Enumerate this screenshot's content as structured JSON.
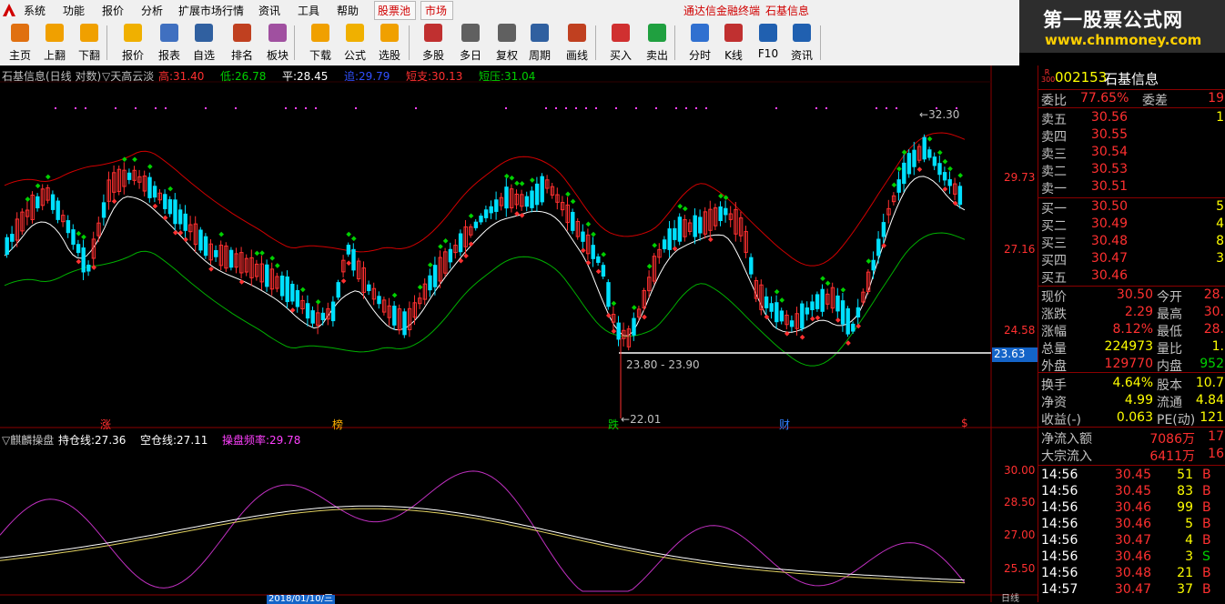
{
  "menubar": {
    "items": [
      "系统",
      "功能",
      "报价",
      "分析",
      "扩展市场行情",
      "资讯",
      "工具",
      "帮助"
    ],
    "tabs": [
      "股票池",
      "市场"
    ],
    "title": "通达信金融终端",
    "stock_name_title": "石基信息"
  },
  "watermark": {
    "title": "第一股票公式网",
    "url": "www.chnmoney.com"
  },
  "toolbar": {
    "buttons": [
      "主页",
      "上翻",
      "下翻",
      "报价",
      "报表",
      "自选",
      "排名",
      "板块",
      "下载",
      "公式",
      "选股",
      "多股",
      "多日",
      "复权",
      "周期",
      "画线",
      "买入",
      "卖出",
      "分时",
      "K线",
      "F10",
      "资讯"
    ]
  },
  "main_chart": {
    "header": {
      "title": "石基信息(日线 对数)",
      "indicator": "天高云淡",
      "items": [
        {
          "label": "高:",
          "value": "31.40",
          "color": "#ff3030"
        },
        {
          "label": "低:",
          "value": "26.78",
          "color": "#00d000"
        },
        {
          "label": "平:",
          "value": "28.45",
          "color": "#ffffff"
        },
        {
          "label": "追:",
          "value": "29.79",
          "color": "#3050ff"
        },
        {
          "label": "短支:",
          "value": "30.13",
          "color": "#ff3030"
        },
        {
          "label": "短压:",
          "value": "31.04",
          "color": "#00d000"
        }
      ]
    },
    "price_axis": [
      "29.73",
      "27.16",
      "24.58"
    ],
    "current_price_tag": "23.63",
    "annotations": {
      "high": "32.30",
      "low": "22.01",
      "range": "23.80 - 23.90"
    },
    "events": [
      "涨",
      "榜",
      "跌",
      "财",
      "$"
    ],
    "overlay_colors": {
      "up": "#00e0ff",
      "down": "#ff3030",
      "upper_band": "#d00000",
      "lower_band": "#00b000",
      "mid": "#ffffff",
      "signal_up": "#00d000",
      "signal_down": "#ff3030",
      "magenta_dots": "#ff40ff"
    }
  },
  "sub_chart": {
    "header": {
      "title": "麒麟操盘",
      "items": [
        {
          "label": "持仓线:",
          "value": "27.36",
          "color": "#ffffff"
        },
        {
          "label": "空仓线:",
          "value": "27.11",
          "color": "#ffffff"
        },
        {
          "label": "操盘频率:",
          "value": "29.78",
          "color": "#ff40ff"
        }
      ]
    },
    "axis": [
      "30.00",
      "28.50",
      "27.00",
      "25.50"
    ]
  },
  "bottom_bar": {
    "date_box": "2018/01/10/三",
    "period": "日线"
  },
  "quote_panel": {
    "code": "002153",
    "name": "石基信息",
    "badge_top": "R",
    "badge_bottom": "300",
    "ratio": {
      "label": "委比",
      "value": "77.65%",
      "label2": "委差",
      "value2": "19"
    },
    "asks": [
      {
        "label": "卖五",
        "price": "30.56",
        "vol": "1"
      },
      {
        "label": "卖四",
        "price": "30.55",
        "vol": ""
      },
      {
        "label": "卖三",
        "price": "30.54",
        "vol": ""
      },
      {
        "label": "卖二",
        "price": "30.53",
        "vol": ""
      },
      {
        "label": "卖一",
        "price": "30.51",
        "vol": ""
      }
    ],
    "bids": [
      {
        "label": "买一",
        "price": "30.50",
        "vol": "5"
      },
      {
        "label": "买二",
        "price": "30.49",
        "vol": "4"
      },
      {
        "label": "买三",
        "price": "30.48",
        "vol": "8"
      },
      {
        "label": "买四",
        "price": "30.47",
        "vol": "3"
      },
      {
        "label": "买五",
        "price": "30.46",
        "vol": ""
      }
    ],
    "stats": [
      {
        "l1": "现价",
        "v1": "30.50",
        "c1": "red",
        "l2": "今开",
        "v2": "28.",
        "c2": "red"
      },
      {
        "l1": "涨跌",
        "v1": "2.29",
        "c1": "red",
        "l2": "最高",
        "v2": "30.",
        "c2": "red"
      },
      {
        "l1": "涨幅",
        "v1": "8.12%",
        "c1": "red",
        "l2": "最低",
        "v2": "28.",
        "c2": "red"
      },
      {
        "l1": "总量",
        "v1": "224973",
        "c1": "yellow",
        "l2": "量比",
        "v2": "1.",
        "c2": "yellow"
      },
      {
        "l1": "外盘",
        "v1": "129770",
        "c1": "red",
        "l2": "内盘",
        "v2": "952",
        "c2": "green"
      },
      {
        "l1": "换手",
        "v1": "4.64%",
        "c1": "yellow",
        "l2": "股本",
        "v2": "10.7",
        "c2": "yellow"
      },
      {
        "l1": "净资",
        "v1": "4.99",
        "c1": "yellow",
        "l2": "流通",
        "v2": "4.84",
        "c2": "yellow"
      },
      {
        "l1": "收益(-)",
        "v1": "0.063",
        "c1": "yellow",
        "l2": "PE(动)",
        "v2": "121",
        "c2": "yellow"
      }
    ],
    "flows": [
      {
        "label": "净流入额",
        "value": "7086万",
        "extra": "17"
      },
      {
        "label": "大宗流入",
        "value": "6411万",
        "extra": "16"
      }
    ],
    "ticks": [
      {
        "time": "14:56",
        "price": "30.45",
        "vol": "51",
        "side": "B"
      },
      {
        "time": "14:56",
        "price": "30.45",
        "vol": "83",
        "side": "B"
      },
      {
        "time": "14:56",
        "price": "30.46",
        "vol": "99",
        "side": "B"
      },
      {
        "time": "14:56",
        "price": "30.46",
        "vol": "5",
        "side": "B"
      },
      {
        "time": "14:56",
        "price": "30.47",
        "vol": "4",
        "side": "B"
      },
      {
        "time": "14:56",
        "price": "30.46",
        "vol": "3",
        "side": "S"
      },
      {
        "time": "14:56",
        "price": "30.48",
        "vol": "21",
        "side": "B"
      },
      {
        "time": "14:57",
        "price": "30.47",
        "vol": "37",
        "side": "B"
      }
    ]
  }
}
